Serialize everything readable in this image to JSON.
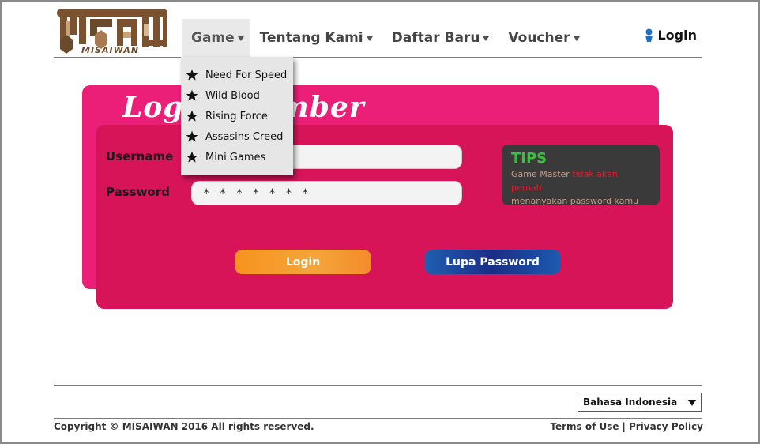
{
  "header": {
    "logo_text": "MISAIWAN",
    "nav": [
      {
        "label": "Game",
        "name": "nav-game"
      },
      {
        "label": "Tentang Kami",
        "name": "nav-tentang-kami"
      },
      {
        "label": "Daftar Baru",
        "name": "nav-daftar-baru"
      },
      {
        "label": "Voucher",
        "name": "nav-voucher"
      }
    ],
    "login_label": "Login"
  },
  "dropdown": {
    "items": [
      "Need For Speed",
      "Wild Blood",
      "Rising Force",
      "Assasins Creed",
      "Mini Games"
    ]
  },
  "login_card": {
    "title": "Login Member",
    "username_label": "Username",
    "password_label": "Password",
    "username_value": "",
    "password_value": "* * * * * * *",
    "login_button": "Login",
    "forgot_button": "Lupa Password"
  },
  "tips": {
    "title": "TIPS",
    "text_part1": "Game Master ",
    "text_part2": "tidak akan pernah",
    "text_part3": "menanyakan password kamu"
  },
  "footer": {
    "language": "Bahasa Indonesia",
    "copyright": "Copyright © MISAIWAN 2016 All rights reserved.",
    "terms": "Terms of Use",
    "separator": "|",
    "privacy": "Privacy Policy"
  },
  "colors": {
    "card_back": "#ec1f78",
    "card_front": "#d81459",
    "tips_bg": "#3a3a3a",
    "tips_title": "#3cbf3c",
    "login_btn": "#f7931e",
    "forgot_btn": "#1b2d86"
  }
}
